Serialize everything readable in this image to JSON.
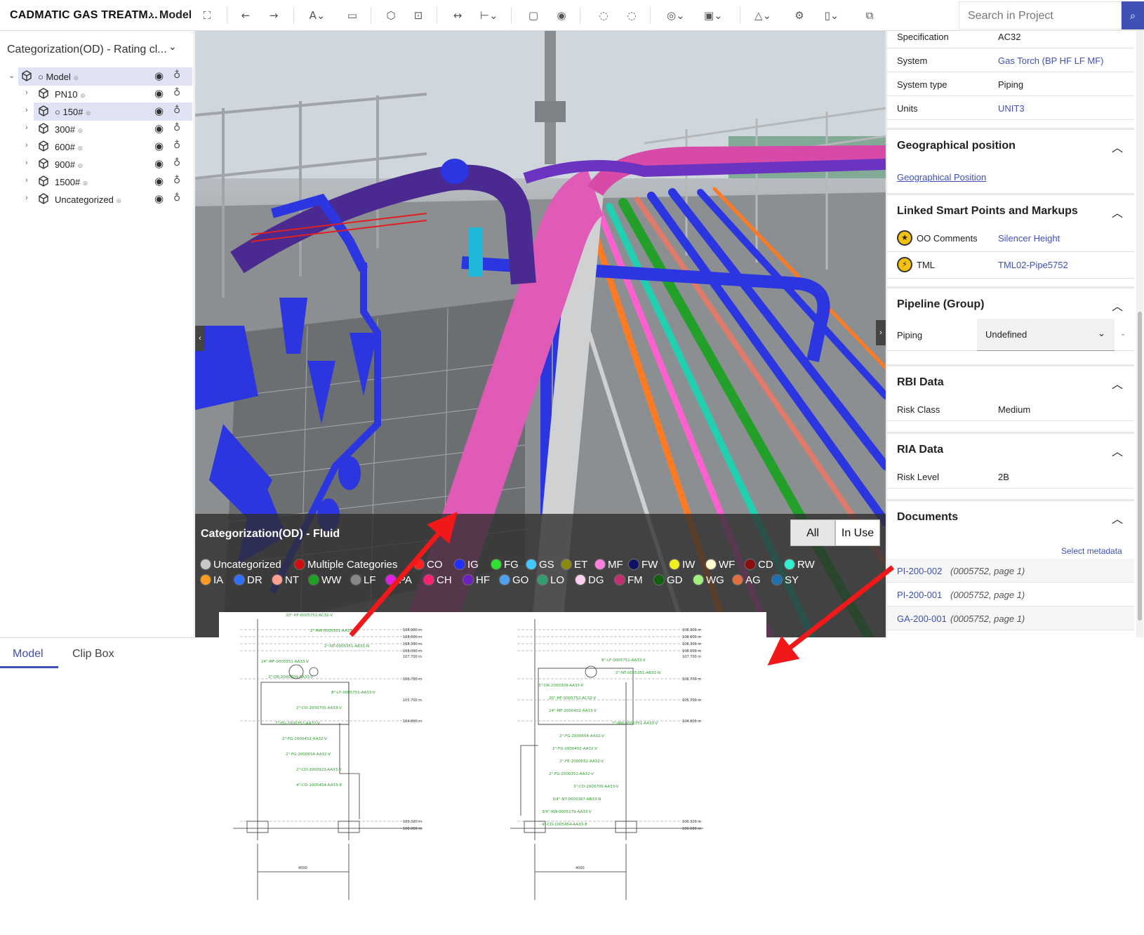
{
  "toolbar": {
    "app_title": "CADMATIC GAS TREATM...",
    "breadcrumb_sep": "›",
    "breadcrumb_current": "Model",
    "search_placeholder": "Search in Project"
  },
  "left_panel": {
    "categorization_select": "Categorization(OD) - Rating cl...",
    "tree": [
      {
        "label": "Model",
        "prefix": "○",
        "level": 0,
        "selected": true
      },
      {
        "label": "PN10",
        "prefix": "",
        "level": 1,
        "selected": false
      },
      {
        "label": "150#",
        "prefix": "○",
        "level": 1,
        "selected": true
      },
      {
        "label": "300#",
        "prefix": "",
        "level": 1,
        "selected": false
      },
      {
        "label": "600#",
        "prefix": "",
        "level": 1,
        "selected": false
      },
      {
        "label": "900#",
        "prefix": "",
        "level": 1,
        "selected": false
      },
      {
        "label": "1500#",
        "prefix": "",
        "level": 1,
        "selected": false
      },
      {
        "label": "Uncategorized",
        "prefix": "",
        "level": 1,
        "selected": false
      }
    ],
    "tabs": {
      "model": "Model",
      "clip_box": "Clip Box"
    }
  },
  "viewport": {
    "legend_title": "Categorization(OD) - Fluid",
    "filter_all": "All",
    "filter_in_use": "In Use",
    "legend_row1": [
      {
        "label": "Uncategorized",
        "color": "#c8c8c8"
      },
      {
        "label": "Multiple Categories",
        "color": "#d01010"
      },
      {
        "label": "CO",
        "color": "#ff2020"
      },
      {
        "label": "IG",
        "color": "#2030ff"
      },
      {
        "label": "FG",
        "color": "#30e030"
      },
      {
        "label": "GS",
        "color": "#40c8ff"
      },
      {
        "label": "ET",
        "color": "#8a8a10"
      },
      {
        "label": "MF",
        "color": "#ff80e0"
      },
      {
        "label": "FW",
        "color": "#101060"
      },
      {
        "label": "IW",
        "color": "#f0f020"
      },
      {
        "label": "WF",
        "color": "#fffad0"
      },
      {
        "label": "CD",
        "color": "#8a1010"
      },
      {
        "label": "RW",
        "color": "#30f0d0"
      }
    ],
    "legend_row2": [
      {
        "label": "IA",
        "color": "#ff9a20"
      },
      {
        "label": "DR",
        "color": "#3070ff"
      },
      {
        "label": "NT",
        "color": "#ffa090"
      },
      {
        "label": "WW",
        "color": "#20a020"
      },
      {
        "label": "LF",
        "color": "#888888"
      },
      {
        "label": "PA",
        "color": "#e020e0"
      },
      {
        "label": "CH",
        "color": "#ff2070"
      },
      {
        "label": "HF",
        "color": "#7020c0"
      },
      {
        "label": "GO",
        "color": "#50a0f0"
      },
      {
        "label": "LO",
        "color": "#30a070"
      },
      {
        "label": "DG",
        "color": "#ffd0f0"
      },
      {
        "label": "FM",
        "color": "#c03070"
      },
      {
        "label": "GD",
        "color": "#106010"
      },
      {
        "label": "WG",
        "color": "#a0f080"
      },
      {
        "label": "AG",
        "color": "#e07040"
      },
      {
        "label": "SY",
        "color": "#2070b0"
      }
    ]
  },
  "right_panel": {
    "properties": [
      {
        "key": "Specification",
        "value": "AC32",
        "link": false
      },
      {
        "key": "System",
        "value": "Gas Torch (BP HF LF MF)",
        "link": true
      },
      {
        "key": "System type",
        "value": "Piping",
        "link": false
      },
      {
        "key": "Units",
        "value": "UNIT3",
        "link": true
      }
    ],
    "geo_section": "Geographical position",
    "geo_link": "Geographical Position",
    "smart_section": "Linked Smart Points and Markups",
    "smart_points": [
      {
        "type": "OO Comments",
        "value": "Silencer Height"
      },
      {
        "type": "TML",
        "value": "TML02-Pipe5752"
      }
    ],
    "pipeline_section": "Pipeline (Group)",
    "piping_key": "Piping",
    "piping_value": "Undefined",
    "rbi_section": "RBI Data",
    "rbi_key": "Risk Class",
    "rbi_value": "Medium",
    "ria_section": "RIA Data",
    "ria_key": "Risk Level",
    "ria_value": "2B",
    "documents_section": "Documents",
    "select_metadata": "Select metadata",
    "documents": [
      {
        "code": "PI-200-002",
        "meta": "(0005752, page 1)"
      },
      {
        "code": "PI-200-001",
        "meta": "(0005752, page 1)"
      },
      {
        "code": "GA-200-001",
        "meta": "(0005752, page 1)"
      }
    ]
  },
  "drawings": {
    "left_labels": [
      "20\"-HF-0005752-AC32-V",
      "2\"-RW-0005351-AA33-V",
      "2\"-NT-0005351-AB33-N",
      "24\"-MF-0005551-AA33-V",
      "3\"-DR-2000309-AA33-V",
      "8\"-LF-0005751-AA33-V",
      "2\"-CO-2000701-AA33-V",
      "2\"-FG-2000352-AA32-V",
      "2\"-FG-2000452-AA32-V",
      "2\"-FG-2000654-AA32-V",
      "2\"-CD-2000923-AA33-V",
      "4\"-CO-1005454-AA33-8"
    ],
    "right_labels": [
      "8\"-LF-0005751-AA33-V",
      "2\"-NT-0005351-AB33-N",
      "3\"-DR-2000309-AA33-V",
      "20\"-HF-0005752-AC32-V",
      "24\"-MF-2000402-AA33-V",
      "2\"-RW-0005351-AA33-V",
      "2\"-FG-2000654-AA32-V",
      "2\"-FG-2000452-AA32-V",
      "2\"-FE-2000552-AA32-V",
      "2\"-FG-2000352-AA32-V",
      "3\"-CD-2000705-AA33-V",
      "3/4\"-NT-0005367-AB33-N",
      "3/4\"-RW-0005179-AA33-V",
      "4\"-CD-1005454-AA33-8"
    ],
    "elevations": [
      "108.900 m",
      "108.600 m",
      "108.300 m",
      "108.000 m",
      "107.700 m",
      "106.700 m",
      "105.700 m",
      "104.800 m",
      "100.320 m",
      "100.000 m"
    ],
    "dimension": "4000"
  }
}
